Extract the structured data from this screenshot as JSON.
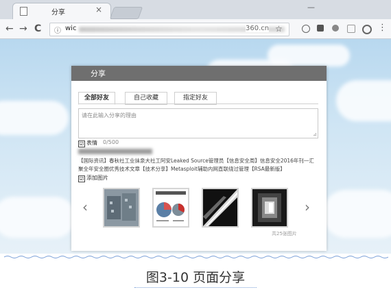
{
  "browser": {
    "tab_title": "分享",
    "tab_close": "×",
    "back_icon": "←",
    "forward_icon": "→",
    "reload_icon": "C",
    "info_icon": "ⓘ",
    "url_start": "wic",
    "url_domain": "360.cn",
    "star_icon": "☆",
    "menu_icon": "⋮"
  },
  "dialog": {
    "title": "分享",
    "tabs": [
      "全部好友",
      "自己收藏",
      "指定好友"
    ],
    "reason_placeholder": "请在此输入分享的理由",
    "resize_icon": "⊿",
    "emoji_check": "☑",
    "emoji_label": "表情",
    "emoji_count": "0/500",
    "share_text": "【国际资讯】春秋社工业抹泉大社工阿安Leaked Source管理员【信息安全周】信息安全2016年刊一汇聚全年安全圈优秀技术文章【技术分享】Metasploit辅助内网直联绕过管理【RSA最新版】",
    "addimg_check": "☑",
    "addimg_label": "添加图片",
    "prev_arrow": "‹",
    "next_arrow": "›",
    "image_count": "共25张图片"
  },
  "caption": "图3-10 页面分享"
}
